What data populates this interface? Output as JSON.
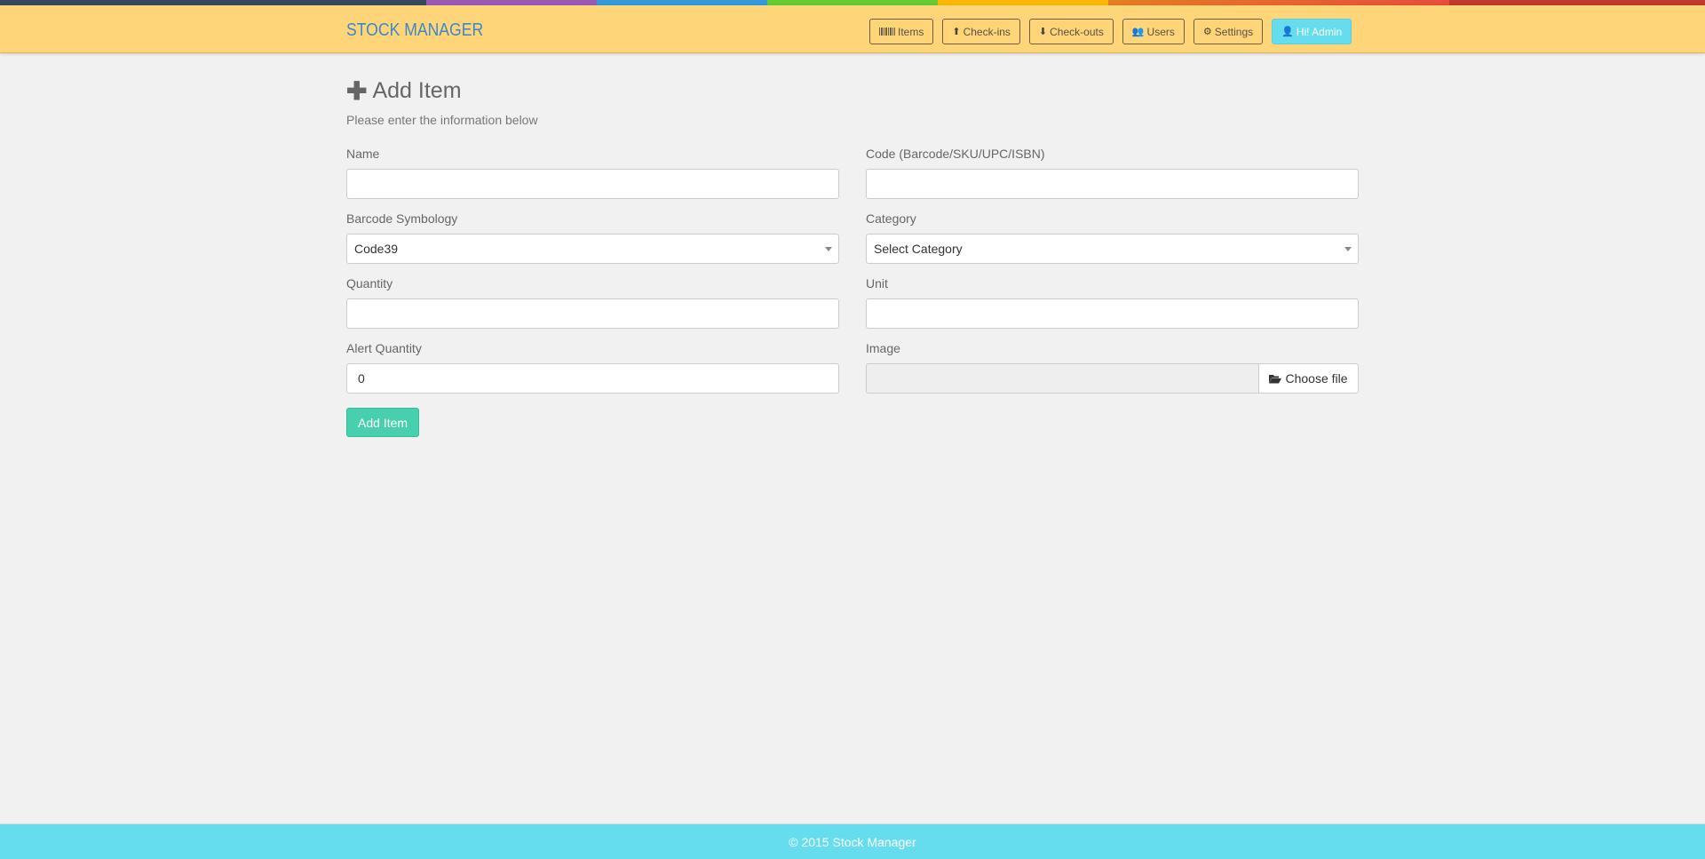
{
  "theme": {
    "rainbow": [
      {
        "color": "#34495e",
        "from": "#34495e",
        "to": "#34495e",
        "share": 25
      },
      {
        "color": "#9b59b6",
        "from": "#9b59b6",
        "to": "#9b59b6",
        "share": 10
      },
      {
        "color": "#3498db",
        "from": "#3498db",
        "to": "#3498db",
        "share": 10
      },
      {
        "color": "#62cb31",
        "from": "#62cb31",
        "to": "#62cb31",
        "share": 10
      },
      {
        "color": "#ffb606",
        "from": "#ffb606",
        "to": "#ffb606",
        "share": 10
      },
      {
        "color": "#e67e22",
        "from": "#e67e22",
        "to": "#e74c3c",
        "share": 20
      },
      {
        "color": "#c0392b",
        "from": "#c0392b",
        "to": "#c0392b",
        "share": 15
      }
    ],
    "navbar_bg": "#ffd57a",
    "brand_color": "#3f86c7",
    "accent_button": "#48cfad",
    "footer_bg": "#66dcef"
  },
  "navbar": {
    "brand": "STOCK MANAGER",
    "buttons": [
      {
        "label": "Items",
        "icon": "barcode-icon"
      },
      {
        "label": "Check-ins",
        "icon": "arrow-circle-up-icon",
        "glyph": "⬆"
      },
      {
        "label": "Check-outs",
        "icon": "arrow-circle-down-icon",
        "glyph": "⬇"
      },
      {
        "label": "Users",
        "icon": "users-icon",
        "glyph": "👥"
      },
      {
        "label": "Settings",
        "icon": "cogs-icon",
        "glyph": "⚙"
      },
      {
        "label": "Hi! Admin",
        "icon": "user-icon",
        "glyph": "👤"
      }
    ]
  },
  "page": {
    "title": "Add Item",
    "title_icon": "plus-icon",
    "subtitle": "Please enter the information below"
  },
  "form": {
    "name": {
      "label": "Name",
      "value": ""
    },
    "code": {
      "label": "Code (Barcode/SKU/UPC/ISBN)",
      "value": ""
    },
    "barcode_symbology": {
      "label": "Barcode Symbology",
      "selected": "Code39"
    },
    "category": {
      "label": "Category",
      "selected": "Select Category"
    },
    "quantity": {
      "label": "Quantity",
      "value": ""
    },
    "unit": {
      "label": "Unit",
      "value": ""
    },
    "alert_quantity": {
      "label": "Alert Quantity",
      "value": "0"
    },
    "image": {
      "label": "Image",
      "button_label": "Choose file",
      "button_icon": "folder-open-icon"
    },
    "submit_label": "Add Item"
  },
  "footer": {
    "text": "© 2015 Stock Manager"
  }
}
